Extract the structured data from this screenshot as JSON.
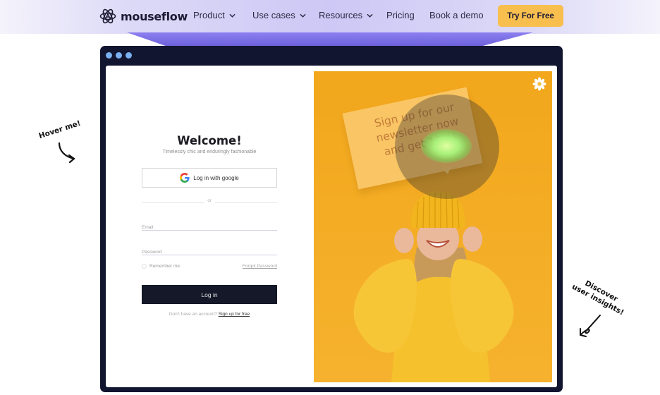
{
  "nav": {
    "brand": "mouseflow",
    "items": [
      {
        "label": "Product",
        "has_dropdown": true
      },
      {
        "label": "Use cases",
        "has_dropdown": true
      },
      {
        "label": "Resources",
        "has_dropdown": true
      },
      {
        "label": "Pricing",
        "has_dropdown": false
      },
      {
        "label": "Book a demo",
        "has_dropdown": false
      }
    ],
    "cta_label": "Try For Free",
    "cta_color": "#f8bf4f"
  },
  "annotations": {
    "hover_me": "Hover me!",
    "discover_line1": "Discover",
    "discover_line2": "user insights!"
  },
  "login": {
    "title": "Welcome!",
    "tagline": "Timelessly chic and enduringly fashionable",
    "google_label": "Log in with google",
    "or_label": "or",
    "email_placeholder": "Email",
    "password_placeholder": "Password",
    "remember_label": "Remember me",
    "forgot_label": "Forgot Password",
    "login_label": "Log in",
    "no_account_text": "Don't have an account?",
    "signup_label": "Sign up for free"
  },
  "promo": {
    "line1": "Sign up for our",
    "line2": "newsletter now",
    "line3": "and get 10%!"
  },
  "colors": {
    "frame": "#121530",
    "accent_purple": "#6d60dc",
    "photo_bg": "#f0a91e",
    "heatmap_hotspot": "#a8f07a"
  }
}
